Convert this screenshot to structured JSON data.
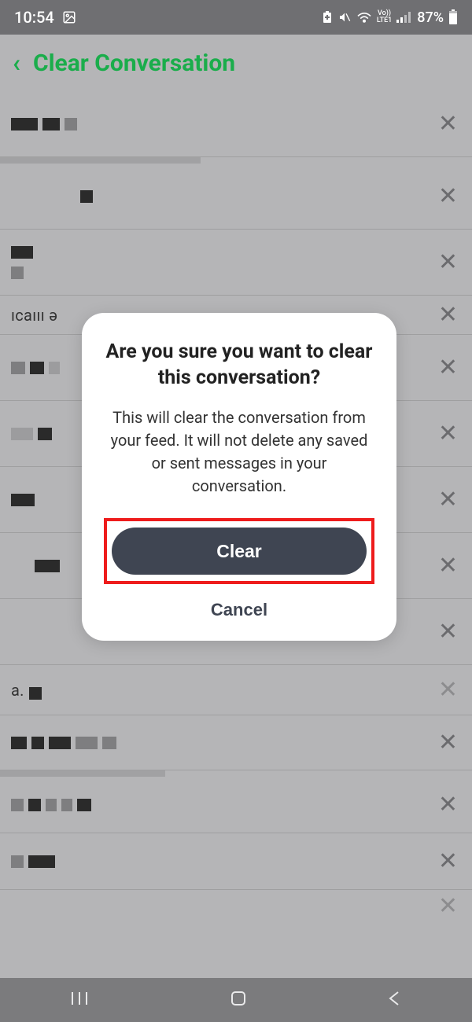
{
  "status": {
    "time": "10:54",
    "battery_pct": "87%",
    "lte_label": "LTE1",
    "vo_label": "Vo))"
  },
  "header": {
    "title": "Clear Conversation"
  },
  "list": {
    "visible_text_row_4": "ıcaııı ə",
    "visible_text_row_10_suffix": "a."
  },
  "modal": {
    "title": "Are you sure you want to clear this conversation?",
    "body": "This will clear the conversation from your feed. It will not delete any saved or sent messages in your conversation.",
    "clear_label": "Clear",
    "cancel_label": "Cancel"
  },
  "colors": {
    "accent_green": "#1aad4b",
    "modal_button": "#3f4552",
    "highlight_red": "#ee1c1c"
  }
}
